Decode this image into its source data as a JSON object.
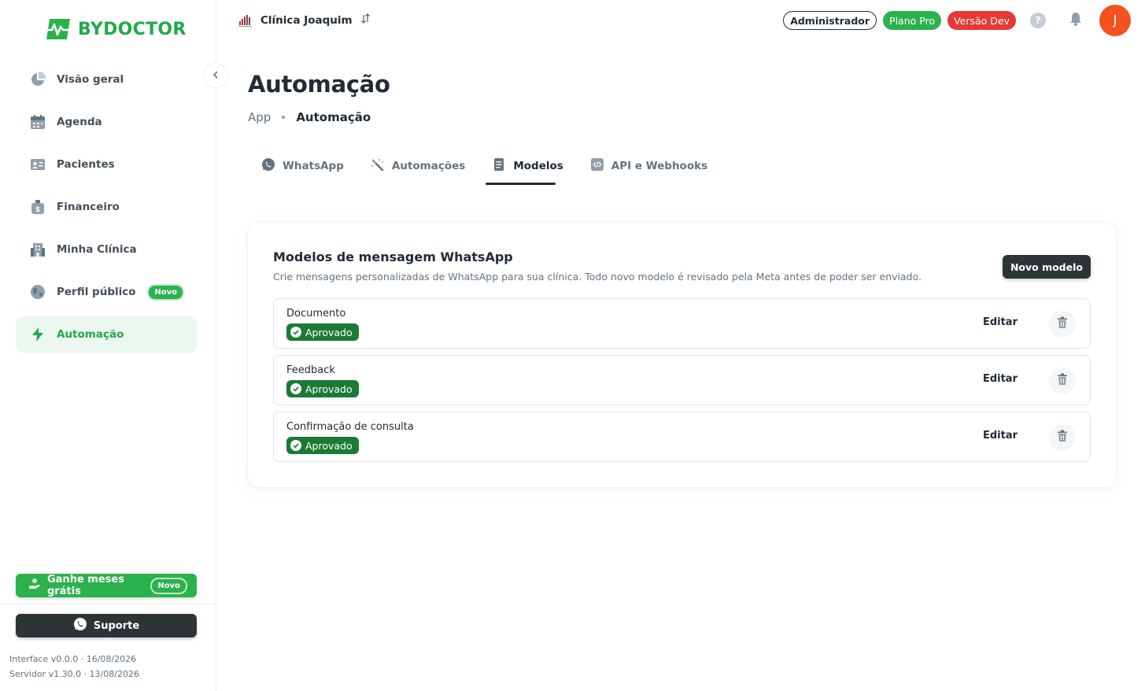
{
  "brand": {
    "name": "BYDOCTOR",
    "color": "#22a84a"
  },
  "sidebar": {
    "items": [
      {
        "label": "Visão geral",
        "icon": "pie-chart-icon"
      },
      {
        "label": "Agenda",
        "icon": "calendar-icon"
      },
      {
        "label": "Pacientes",
        "icon": "id-card-icon"
      },
      {
        "label": "Financeiro",
        "icon": "money-bag-icon"
      },
      {
        "label": "Minha Clínica",
        "icon": "building-icon"
      },
      {
        "label": "Perfil público",
        "icon": "globe-icon",
        "badge": "Novo"
      },
      {
        "label": "Automação",
        "icon": "bolt-icon",
        "active": true
      }
    ],
    "promo": {
      "label": "Ganhe meses grátis",
      "badge": "Novo"
    },
    "support_label": "Suporte",
    "versions": {
      "interface": "Interface v0.0.0 · 16/08/2026",
      "server": "Servidor v1.30.0 · 13/08/2026"
    }
  },
  "topbar": {
    "clinic_name": "Clínica Joaquim",
    "role": "Administrador",
    "plan": "Plano Pro",
    "version": "Versão Dev",
    "help": "?",
    "avatar_initial": "J"
  },
  "page": {
    "title": "Automação",
    "breadcrumb": {
      "root": "App",
      "current": "Automação"
    }
  },
  "tabs": [
    {
      "label": "WhatsApp",
      "icon": "whatsapp-icon"
    },
    {
      "label": "Automações",
      "icon": "magic-wand-icon"
    },
    {
      "label": "Modelos",
      "icon": "document-icon",
      "active": true
    },
    {
      "label": "API e Webhooks",
      "icon": "code-icon"
    }
  ],
  "templates_card": {
    "title": "Modelos de mensagem WhatsApp",
    "subtitle": "Crie mensagens personalizadas de WhatsApp para sua clínica. Todo novo modelo é revisado pela Meta antes de poder ser enviado.",
    "new_button": "Novo modelo",
    "edit_label": "Editar",
    "rows": [
      {
        "name": "Documento",
        "status": "Aprovado"
      },
      {
        "name": "Feedback",
        "status": "Aprovado"
      },
      {
        "name": "Confirmação de consulta",
        "status": "Aprovado"
      }
    ]
  },
  "colors": {
    "accent_green": "#2bb24c",
    "approved_green": "#1b7a34",
    "dev_red": "#e53935",
    "dark": "#2d3436",
    "avatar": "#f4511e"
  }
}
